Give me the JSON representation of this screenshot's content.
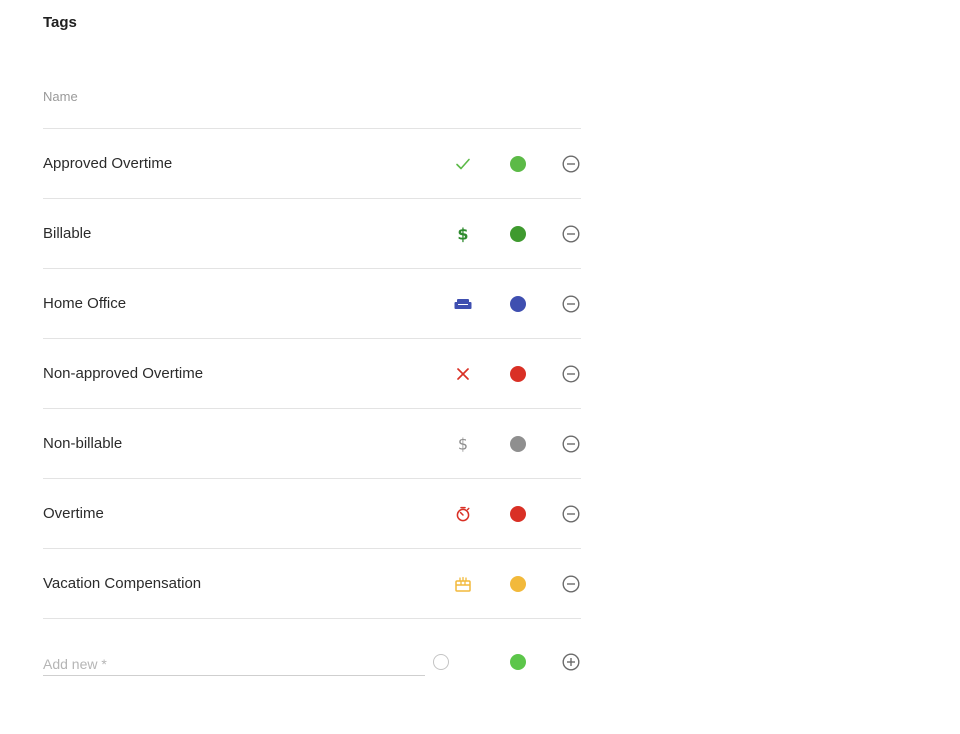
{
  "title": "Tags",
  "header": {
    "name": "Name"
  },
  "tags": [
    {
      "name": "Approved Overtime",
      "icon": "check-icon",
      "icon_color": "#5cba47",
      "color": "#5cba47"
    },
    {
      "name": "Billable",
      "icon": "dollar-icon",
      "icon_color": "#2e8b2e",
      "color": "#3f9a2f"
    },
    {
      "name": "Home Office",
      "icon": "sofa-icon",
      "icon_color": "#3f4fb0",
      "color": "#3f4fb0"
    },
    {
      "name": "Non-approved Overtime",
      "icon": "cross-icon",
      "icon_color": "#d93025",
      "color": "#d93025"
    },
    {
      "name": "Non-billable",
      "icon": "dollar-icon",
      "icon_color": "#8f8f8f",
      "color": "#8f8f8f"
    },
    {
      "name": "Overtime",
      "icon": "stopwatch-icon",
      "icon_color": "#d93025",
      "color": "#d93025"
    },
    {
      "name": "Vacation Compensation",
      "icon": "gift-icon",
      "icon_color": "#f2b93b",
      "color": "#f2b93b"
    }
  ],
  "add_new": {
    "placeholder": "Add new *",
    "color": "#5cc64a"
  }
}
